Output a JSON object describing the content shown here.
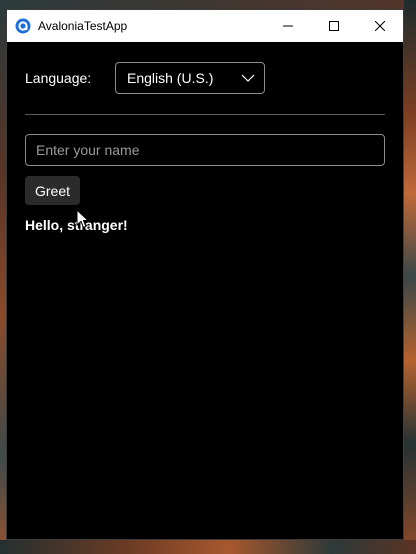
{
  "window": {
    "title": "AvaloniaTestApp",
    "icon": "avalonia-logo-icon",
    "controls": {
      "minimize_icon": "minimize-icon",
      "maximize_icon": "maximize-icon",
      "close_icon": "close-icon"
    }
  },
  "language": {
    "label": "Language:",
    "selected": "English (U.S.)",
    "dropdown_icon": "chevron-down-icon"
  },
  "name_input": {
    "value": "",
    "placeholder": "Enter your name"
  },
  "greet_button": {
    "label": "Greet"
  },
  "greeting_text": "Hello, stranger!",
  "colors": {
    "window_background": "#000000",
    "titlebar_background": "#ffffff",
    "button_background": "#2b2b2b",
    "border": "#8c8c8c",
    "app_icon": "#1e6fd9"
  }
}
